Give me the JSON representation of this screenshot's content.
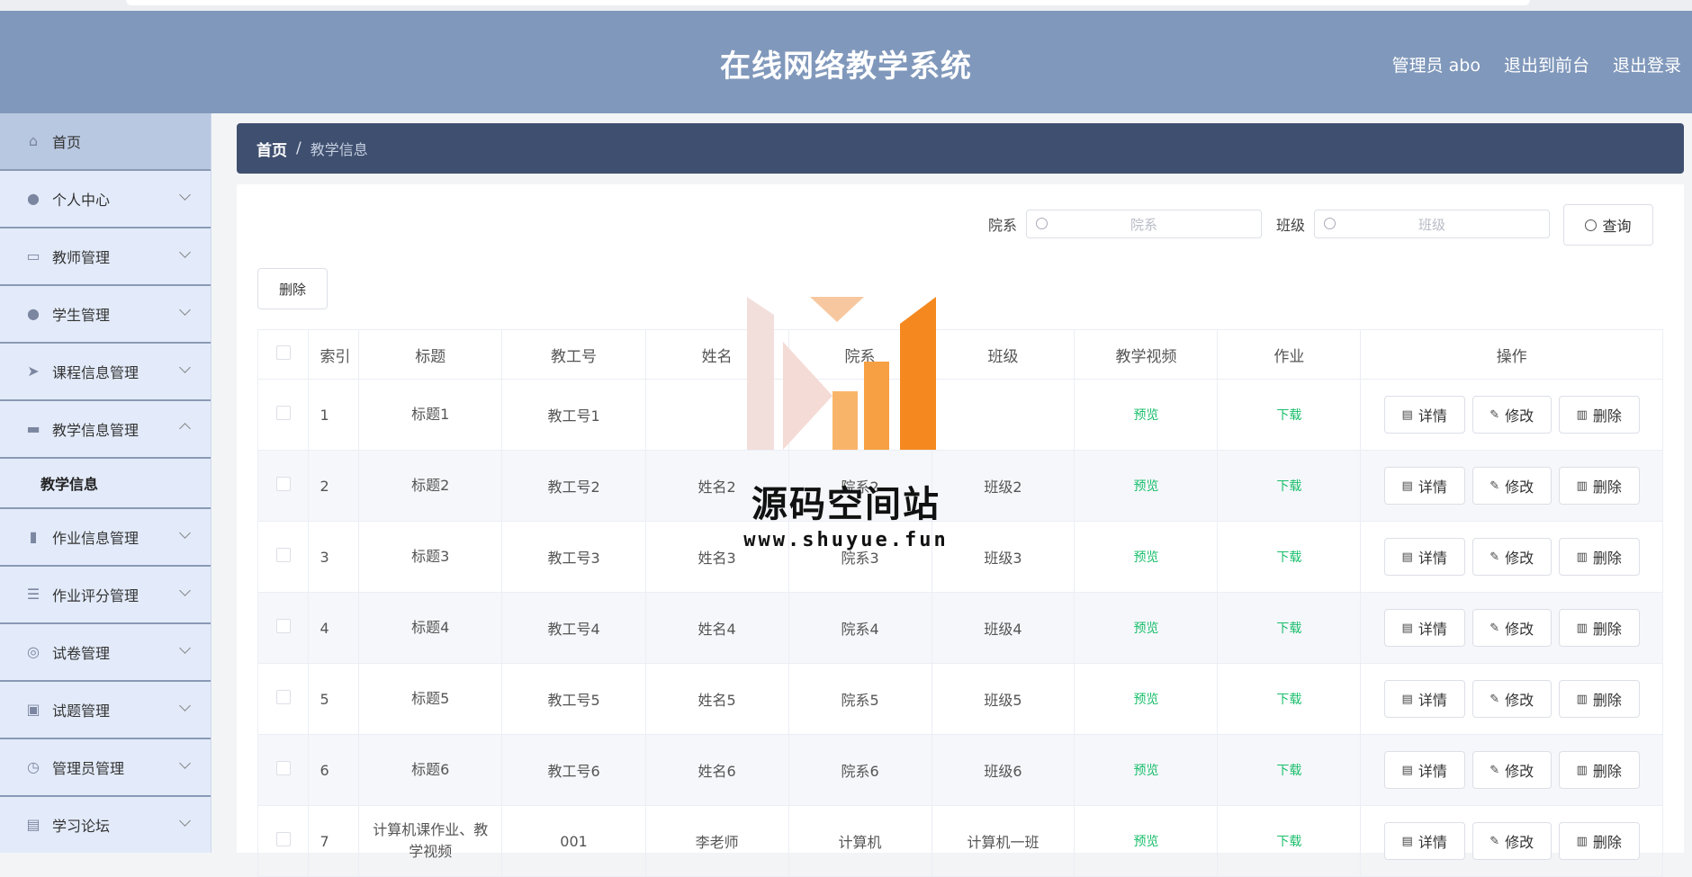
{
  "header": {
    "title": "在线网络教学系统",
    "admin": "管理员 abo",
    "front": "退出到前台",
    "logout": "退出登录"
  },
  "sidebar": {
    "items": [
      {
        "label": "首页",
        "icon": "home-icon"
      },
      {
        "label": "个人中心",
        "icon": "user-icon"
      },
      {
        "label": "教师管理",
        "icon": "chat-icon"
      },
      {
        "label": "学生管理",
        "icon": "user-icon"
      },
      {
        "label": "课程信息管理",
        "icon": "send-icon"
      },
      {
        "label": "教学信息管理",
        "icon": "briefcase-icon"
      },
      {
        "label": "作业信息管理",
        "icon": "chart-icon"
      },
      {
        "label": "作业评分管理",
        "icon": "sliders-icon"
      },
      {
        "label": "试卷管理",
        "icon": "lifebuoy-icon"
      },
      {
        "label": "试题管理",
        "icon": "clipboard-icon"
      },
      {
        "label": "管理员管理",
        "icon": "compass-icon"
      },
      {
        "label": "学习论坛",
        "icon": "card-icon"
      }
    ],
    "sub_item": "教学信息"
  },
  "breadcrumb": {
    "home": "首页",
    "sep": "/",
    "current": "教学信息"
  },
  "search": {
    "dept_label": "院系",
    "dept_placeholder": "院系",
    "class_label": "班级",
    "class_placeholder": "班级",
    "query_button": "查询"
  },
  "toolbar": {
    "delete_label": "删除"
  },
  "table": {
    "headers": [
      "索引",
      "标题",
      "教工号",
      "姓名",
      "院系",
      "班级",
      "教学视频",
      "作业",
      "操作"
    ],
    "rows": [
      {
        "index": "1",
        "title": "标题1",
        "teacher_no": "教工号1",
        "name": "",
        "dept": "",
        "cls": "",
        "video": "预览",
        "hw": "下载"
      },
      {
        "index": "2",
        "title": "标题2",
        "teacher_no": "教工号2",
        "name": "姓名2",
        "dept": "院系2",
        "cls": "班级2",
        "video": "预览",
        "hw": "下载"
      },
      {
        "index": "3",
        "title": "标题3",
        "teacher_no": "教工号3",
        "name": "姓名3",
        "dept": "院系3",
        "cls": "班级3",
        "video": "预览",
        "hw": "下载"
      },
      {
        "index": "4",
        "title": "标题4",
        "teacher_no": "教工号4",
        "name": "姓名4",
        "dept": "院系4",
        "cls": "班级4",
        "video": "预览",
        "hw": "下载"
      },
      {
        "index": "5",
        "title": "标题5",
        "teacher_no": "教工号5",
        "name": "姓名5",
        "dept": "院系5",
        "cls": "班级5",
        "video": "预览",
        "hw": "下载"
      },
      {
        "index": "6",
        "title": "标题6",
        "teacher_no": "教工号6",
        "name": "姓名6",
        "dept": "院系6",
        "cls": "班级6",
        "video": "预览",
        "hw": "下载"
      },
      {
        "index": "7",
        "title": "计算机课作业、教学视频",
        "teacher_no": "001",
        "name": "李老师",
        "dept": "计算机",
        "cls": "计算机一班",
        "video": "预览",
        "hw": "下载"
      }
    ],
    "actions": {
      "detail": "详情",
      "edit": "修改",
      "delete": "删除"
    }
  },
  "watermark": {
    "title": "源码空间站",
    "url": "www.shuyue.fun"
  },
  "colors": {
    "header_bg": "#8098bb",
    "crumb_bg": "#3f4f6f",
    "sidebar_bg": "#e3ebfa",
    "link_green": "#19be6b",
    "logo_orange": "#f5891f"
  }
}
